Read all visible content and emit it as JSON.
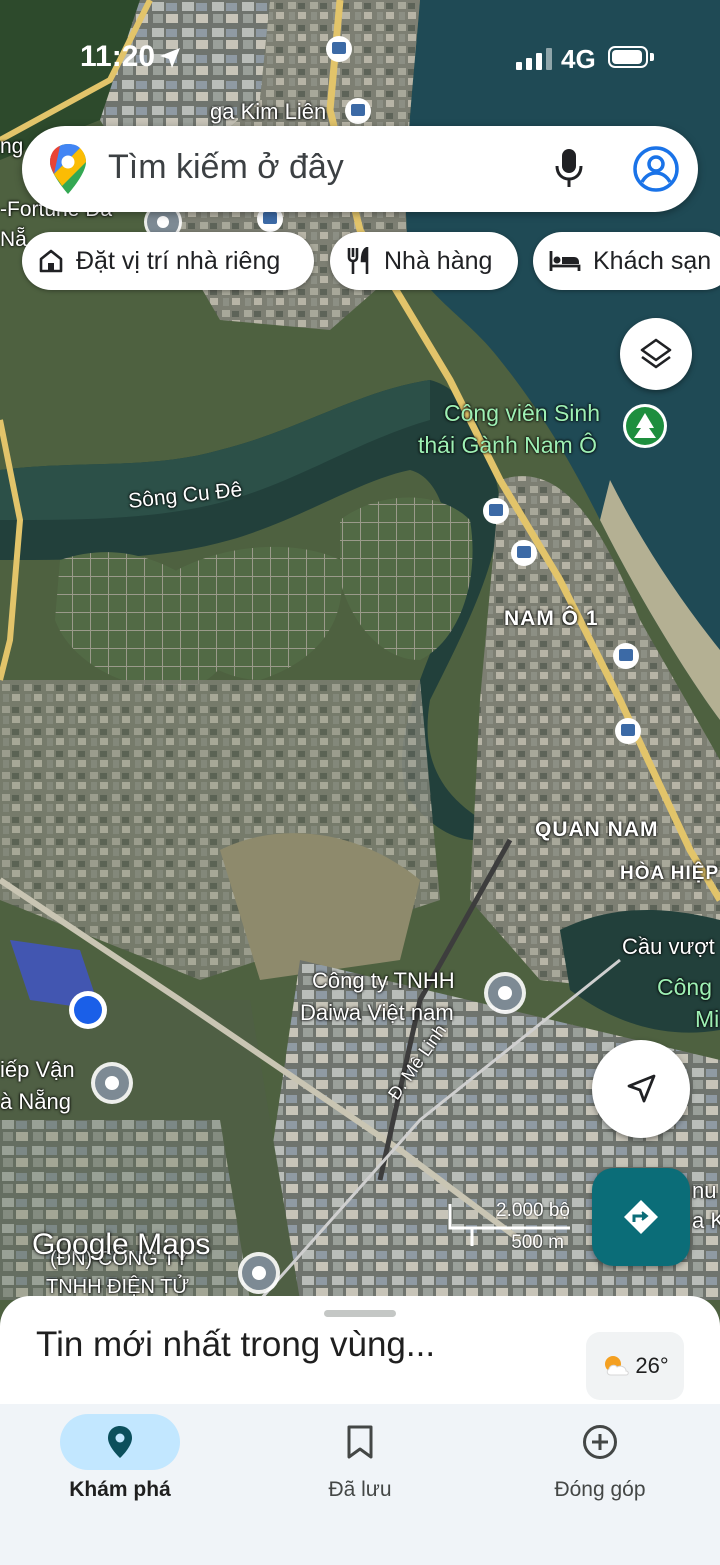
{
  "status_bar": {
    "time": "11:20",
    "network": "4G"
  },
  "search": {
    "placeholder": "Tìm kiếm ở đây"
  },
  "chips": {
    "home": "Đặt vị trí nhà riêng",
    "restaurants": "Nhà hàng",
    "hotels": "Khách sạn"
  },
  "map_labels": {
    "kim_lien": "ga Kim Liên",
    "fortune": "-Fortune Đa",
    "nang_top": "Nẵ",
    "ng_left": "ng",
    "park_line1": "Công viên Sinh",
    "park_line2": "thái Gành Nam Ô",
    "river": "Sông Cu Đê",
    "nam_o": "NAM Ô 1",
    "quan_nam": "QUAN NAM",
    "hoa_hiep": "HÒA HIỆP",
    "cau_vuot": "Cầu vượt",
    "cong_right": "Công",
    "mi_right": "Mi",
    "daiwa_line1": "Công ty TNHH",
    "daiwa_line2": "Daiwa Việt nam",
    "me_linh": "Đ. Mê Linh",
    "tiep_van_line1": "iếp Vận",
    "tiep_van_line2": "à Nẵng",
    "dien_tu_line1": "(ĐN) CÔNG TY",
    "dien_tu_line2": "TNHH ĐIỆN TỬ",
    "nhu_right1": "nu C",
    "nhu_right2": "a K"
  },
  "map_wordmark": "Google Maps",
  "scale": {
    "imperial": "2.000 bộ",
    "metric": "500 m"
  },
  "sheet": {
    "title": "Tin mới nhất trong vùng...",
    "temperature": "26°"
  },
  "bottom_nav": [
    {
      "label": "Khám phá",
      "active": true
    },
    {
      "label": "Đã lưu",
      "active": false
    },
    {
      "label": "Đóng góp",
      "active": false
    }
  ],
  "colors": {
    "accent": "#0b6d78",
    "active_pill": "#c2e7ff",
    "user_location": "#1a5fe8",
    "park_pin": "#1e8e3e"
  }
}
